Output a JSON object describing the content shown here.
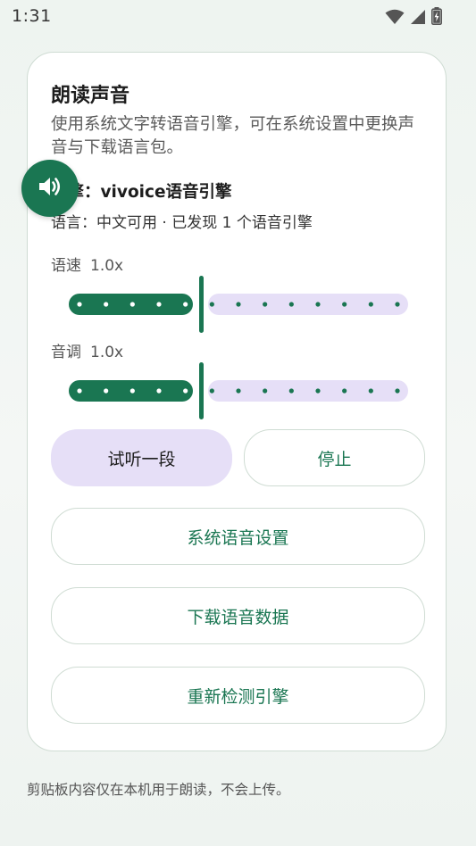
{
  "status_bar": {
    "time": "1:31",
    "icons": [
      "wifi-icon",
      "signal-icon",
      "battery-icon"
    ]
  },
  "card": {
    "title": "朗读声音",
    "description": "使用系统文字转语音引擎，可在系统设置中更换声音与下载语言包。",
    "engine_line": "引擎：vivoice语音引擎",
    "language_line": "语言：中文可用 · 已发现 1 个语音引擎",
    "fab_icon": "speaker-icon",
    "speed": {
      "label": "语速",
      "value_text": "1.0x",
      "level": 0.4
    },
    "pitch": {
      "label": "音调",
      "value_text": "1.0x",
      "level": 0.4
    },
    "buttons": {
      "preview": "试听一段",
      "stop": "停止",
      "system_settings": "系统语音设置",
      "download_data": "下载语音数据",
      "redetect": "重新检测引擎"
    }
  },
  "footer": {
    "note": "剪贴板内容仅在本机用于朗读，不会上传。"
  },
  "colors": {
    "accent": "#1a7652",
    "track_inactive": "#e6dff7",
    "primary_button": "#e6dff7",
    "card_border": "#cfdcd3"
  }
}
